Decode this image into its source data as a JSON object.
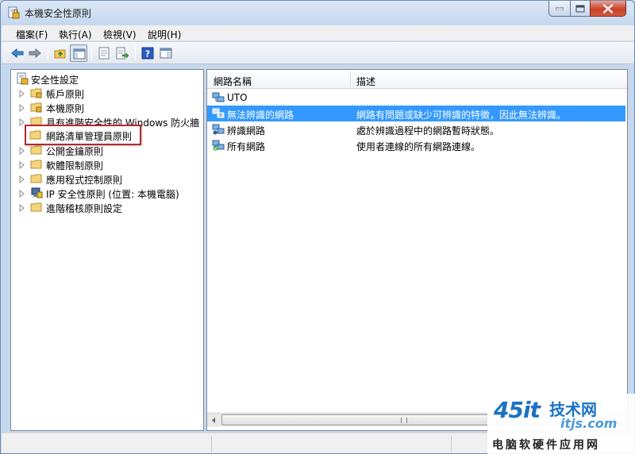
{
  "window": {
    "title": "本機安全性原則"
  },
  "menubar": {
    "items": [
      "檔案(F)",
      "執行(A)",
      "檢視(V)",
      "說明(H)"
    ]
  },
  "toolbar": {
    "buttons": [
      "back-icon",
      "forward-icon",
      "up-folder-icon",
      "show-hide-tree-icon",
      "properties-icon",
      "export-list-icon",
      "help-icon",
      "mmc-view-icon"
    ]
  },
  "tree": {
    "root": "安全性設定",
    "items": [
      {
        "label": "帳戶原則"
      },
      {
        "label": "本機原則"
      },
      {
        "label": "具有進階安全性的 Windows 防火牆"
      },
      {
        "label": "網路清單管理員原則"
      },
      {
        "label": "公開金鑰原則"
      },
      {
        "label": "軟體限制原則"
      },
      {
        "label": "應用程式控制原則"
      },
      {
        "label": "IP 安全性原則 (位置: 本機電腦)"
      },
      {
        "label": "進階稽核原則設定"
      }
    ]
  },
  "list": {
    "columns": [
      "網路名稱",
      "描述"
    ],
    "rows": [
      {
        "name": "UTO",
        "description": ""
      },
      {
        "name": "無法辨識的網路",
        "description": "網路有問題或缺少可辨識的特徵，因此無法辨識。"
      },
      {
        "name": "辨識網路",
        "description": "處於辨識過程中的網路暫時狀態。"
      },
      {
        "name": "所有網路",
        "description": "使用者連線的所有網路連線。"
      }
    ]
  },
  "watermark": {
    "brand": "45it",
    "sub": "技术网",
    "url": "itjs.com",
    "line": "电脑软硬件应用网"
  },
  "colors": {
    "selection": "#3399ff",
    "highlight_border": "#b8262c",
    "watermark_blue": "#1c72c4"
  }
}
